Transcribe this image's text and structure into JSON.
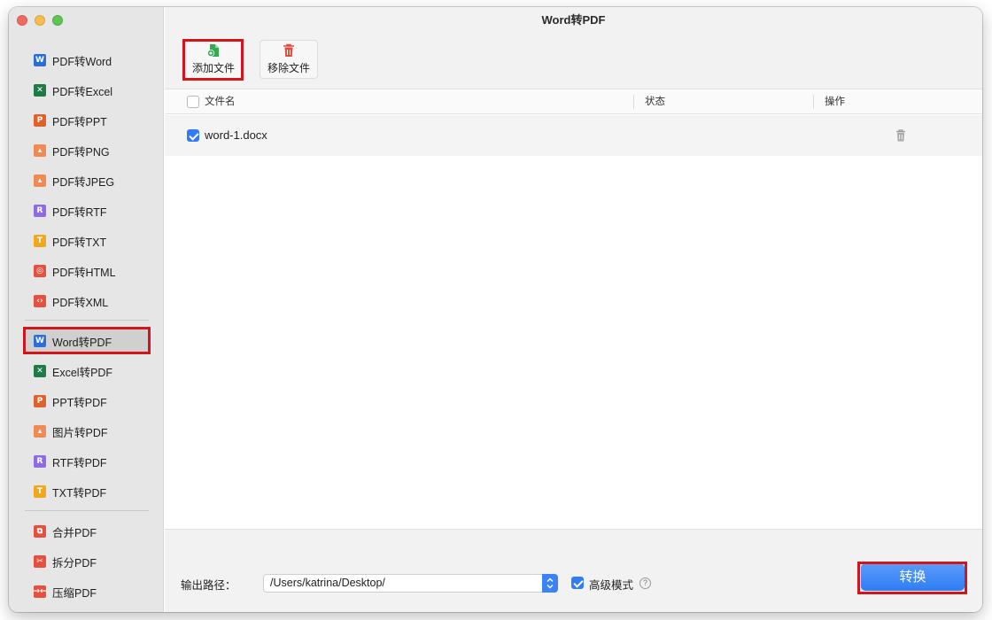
{
  "window": {
    "title": "Word转PDF"
  },
  "colors": {
    "accent": "#2f7cf6",
    "highlight": "#d4141b",
    "add_icon": "#36a853",
    "remove_icon": "#e04b3a"
  },
  "sidebar": {
    "group1": [
      {
        "label": "PDF转Word",
        "icon": "word-icon",
        "glyph": "W",
        "color": "#2b6fd6"
      },
      {
        "label": "PDF转Excel",
        "icon": "excel-icon",
        "glyph": "✕",
        "color": "#1f7a46"
      },
      {
        "label": "PDF转PPT",
        "icon": "ppt-icon",
        "glyph": "P",
        "color": "#e0622a"
      },
      {
        "label": "PDF转PNG",
        "icon": "image-icon",
        "glyph": "▴",
        "color": "#f08a54"
      },
      {
        "label": "PDF转JPEG",
        "icon": "image-icon",
        "glyph": "▴",
        "color": "#f08a54"
      },
      {
        "label": "PDF转RTF",
        "icon": "rtf-icon",
        "glyph": "R",
        "color": "#8d6ce0"
      },
      {
        "label": "PDF转TXT",
        "icon": "txt-icon",
        "glyph": "T",
        "color": "#f2a81d"
      },
      {
        "label": "PDF转HTML",
        "icon": "globe-icon",
        "glyph": "◎",
        "color": "#e2523f"
      },
      {
        "label": "PDF转XML",
        "icon": "code-icon",
        "glyph": "‹›",
        "color": "#e2523f"
      }
    ],
    "group2": [
      {
        "label": "Word转PDF",
        "icon": "word-icon",
        "glyph": "W",
        "color": "#2b6fd6"
      },
      {
        "label": "Excel转PDF",
        "icon": "excel-icon",
        "glyph": "✕",
        "color": "#1f7a46"
      },
      {
        "label": "PPT转PDF",
        "icon": "ppt-icon",
        "glyph": "P",
        "color": "#e0622a"
      },
      {
        "label": "图片转PDF",
        "icon": "image-icon",
        "glyph": "▴",
        "color": "#f08a54"
      },
      {
        "label": "RTF转PDF",
        "icon": "rtf-icon",
        "glyph": "R",
        "color": "#8d6ce0"
      },
      {
        "label": "TXT转PDF",
        "icon": "txt-icon",
        "glyph": "T",
        "color": "#f2a81d"
      }
    ],
    "group3": [
      {
        "label": "合并PDF",
        "icon": "merge-icon",
        "glyph": "⧉",
        "color": "#e2523f"
      },
      {
        "label": "拆分PDF",
        "icon": "scissors-icon",
        "glyph": "✂",
        "color": "#e2523f"
      },
      {
        "label": "压缩PDF",
        "icon": "compress-icon",
        "glyph": "→←",
        "color": "#e2523f"
      }
    ],
    "active": "Word转PDF"
  },
  "toolbar": {
    "add_label": "添加文件",
    "remove_label": "移除文件"
  },
  "table": {
    "columns": {
      "name": "文件名",
      "status": "状态",
      "action": "操作"
    },
    "rows": [
      {
        "name": "word-1.docx",
        "checked": true,
        "status": ""
      }
    ]
  },
  "footer": {
    "output_label": "输出路径：",
    "output_path": "/Users/katrina/Desktop/",
    "advanced_label": "高级模式",
    "advanced_checked": true,
    "help_glyph": "?",
    "convert_label": "转换"
  }
}
